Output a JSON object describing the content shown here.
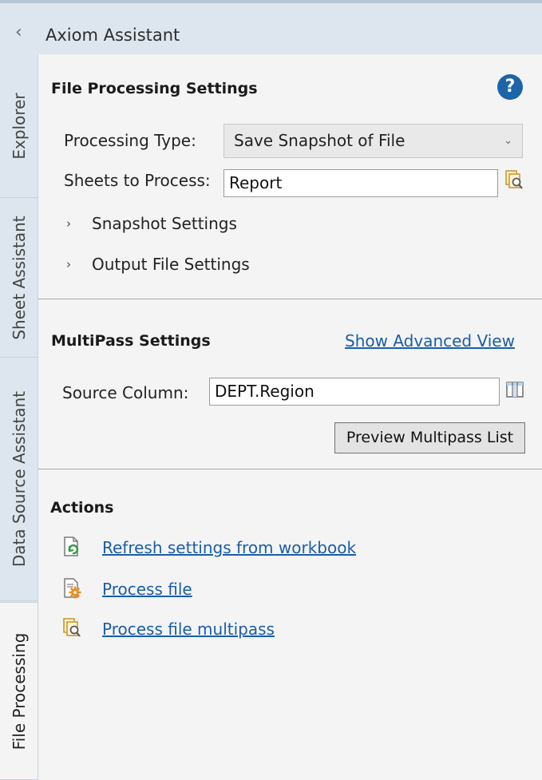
{
  "header": {
    "collapse_glyph": "‹",
    "title": "Axiom Assistant"
  },
  "side_tabs": [
    {
      "label": "Explorer",
      "active": false
    },
    {
      "label": "Sheet Assistant",
      "active": false
    },
    {
      "label": "Data Source Assistant",
      "active": false
    },
    {
      "label": "File Processing",
      "active": true
    }
  ],
  "file_processing": {
    "title": "File Processing Settings",
    "help_glyph": "?",
    "processing_type_label": "Processing Type:",
    "processing_type_value": "Save Snapshot of File",
    "processing_type_chevron": "⌄",
    "sheets_label": "Sheets to Process:",
    "sheets_value": "Report",
    "expanders": [
      {
        "arrow": "›",
        "label": "Snapshot Settings"
      },
      {
        "arrow": "›",
        "label": "Output File Settings"
      }
    ]
  },
  "multipass": {
    "title": "MultiPass Settings",
    "advanced_link": "Show Advanced View",
    "source_column_label": "Source Column:",
    "source_column_value": "DEPT.Region",
    "preview_button": "Preview Multipass List"
  },
  "actions": {
    "title": "Actions",
    "items": [
      {
        "label": "Refresh settings from workbook",
        "icon": "refresh-document-icon"
      },
      {
        "label": "Process file",
        "icon": "process-document-icon"
      },
      {
        "label": "Process file multipass",
        "icon": "multipass-documents-icon"
      }
    ]
  },
  "colors": {
    "accent_link": "#1a5ea8",
    "help_icon": "#1e64a8",
    "header_bg": "#dde6ee",
    "panel_bg": "#f4f4f4"
  }
}
